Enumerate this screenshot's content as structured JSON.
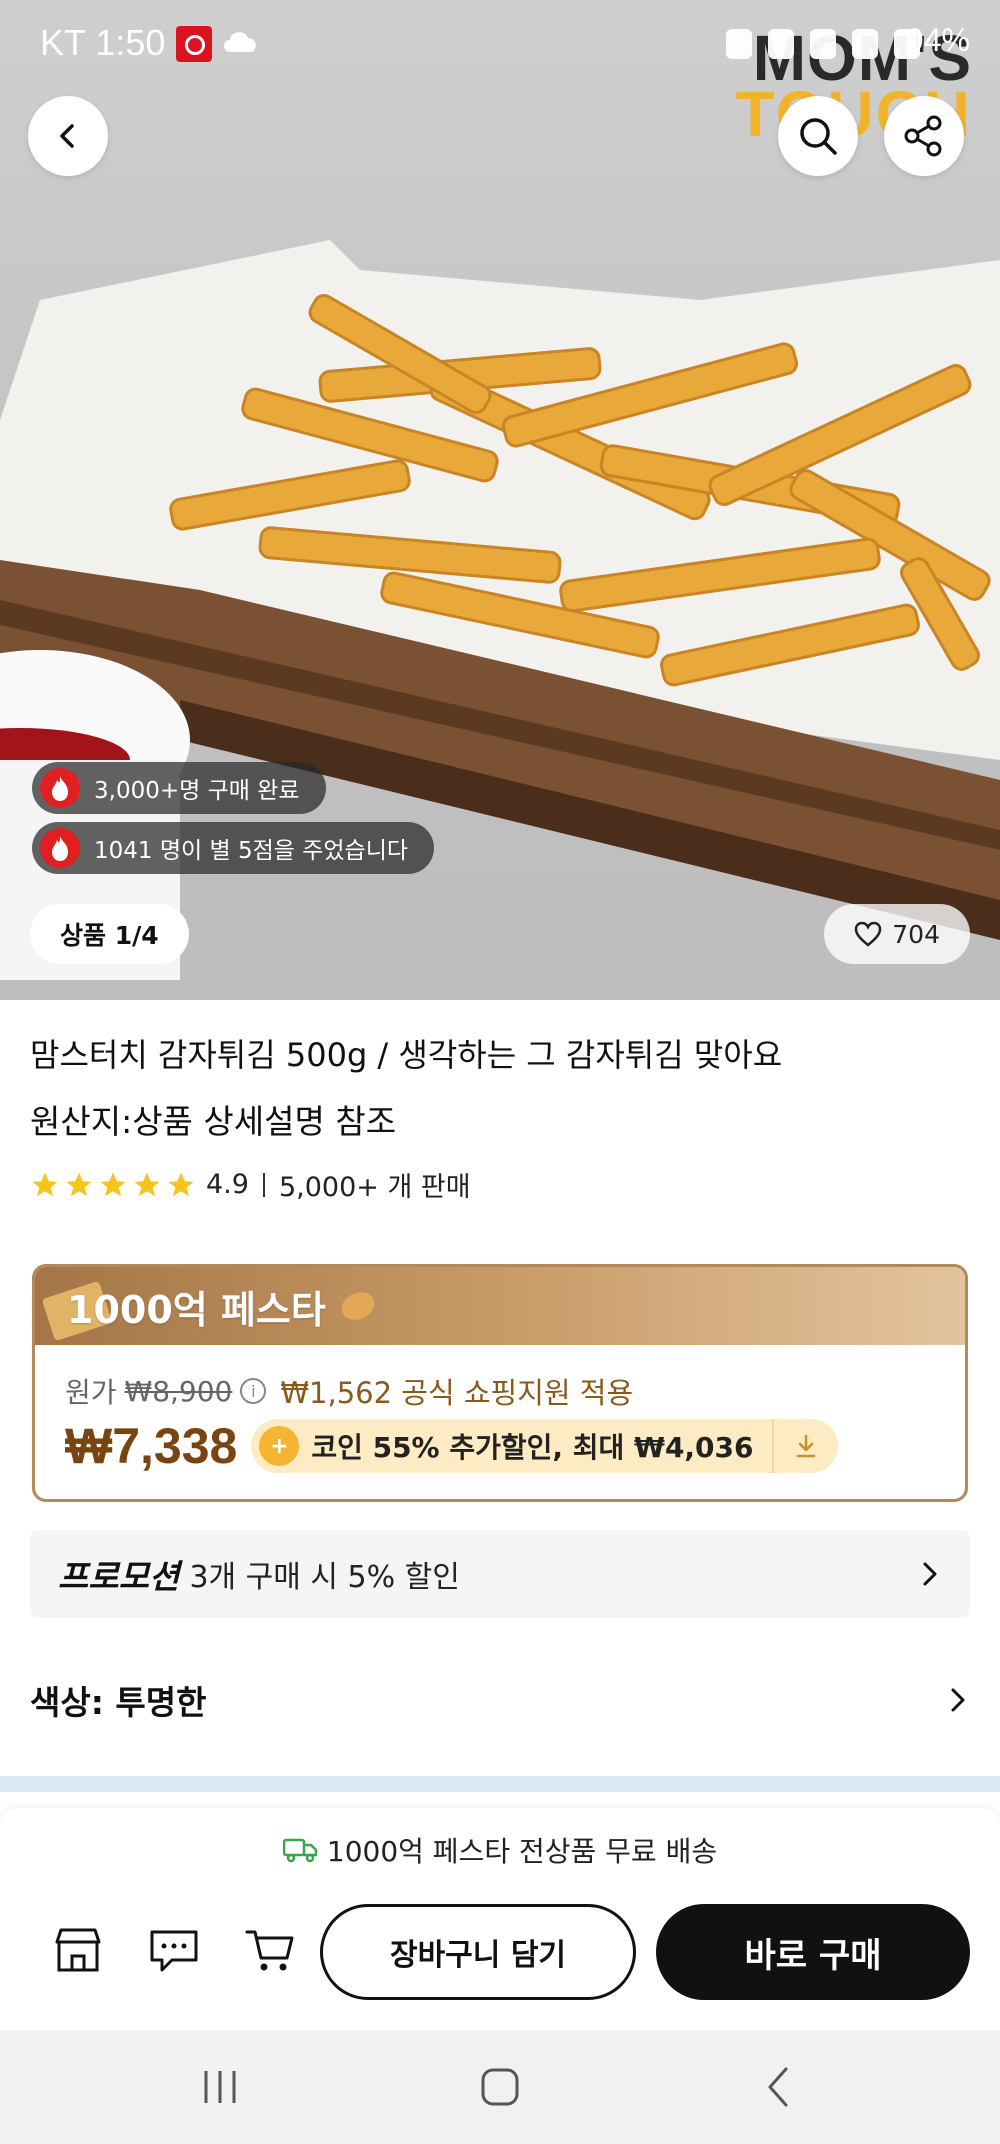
{
  "status_bar": {
    "time": "KT 1:50",
    "battery": "94%"
  },
  "brand_logo": {
    "line1": "MOM'S",
    "line2": "TOUCH"
  },
  "hero": {
    "badge_purchases": "3,000+명 구매 완료",
    "badge_reviews": "1041 명이 별 5점을 주었습니다",
    "image_counter": "상품 1/4",
    "wishlist_count": "704"
  },
  "product": {
    "title": "맘스터치 감자튀김 500g / 생각하는 그 감자튀김 맞아요",
    "origin": "원산지:상품 상세설명 참조",
    "rating": {
      "stars": 5,
      "score": "4.9",
      "sold": "5,000+ 개 판매"
    }
  },
  "festa": {
    "title": "1000억 페스타",
    "original_label": "원가",
    "original_price": "₩8,900",
    "support_text": "₩1,562 공식 쇼핑지원 적용",
    "final_price": "₩7,338",
    "coin_text": "코인 55% 추가할인, 최대 ₩4,036"
  },
  "promotion": {
    "label": "프로모션",
    "text": "3개 구매 시 5% 할인"
  },
  "option": {
    "color_label": "색상: 투명한"
  },
  "bottom_bar": {
    "shipping_text": "1000억 페스타 전상품 무료 배송",
    "cart_button": "장바구니 담기",
    "buy_button": "바로 구매"
  },
  "colors": {
    "accent_brown": "#7a4410",
    "festa_border": "#b38a57",
    "buy_black": "#111111",
    "fire_red": "#e02020"
  }
}
